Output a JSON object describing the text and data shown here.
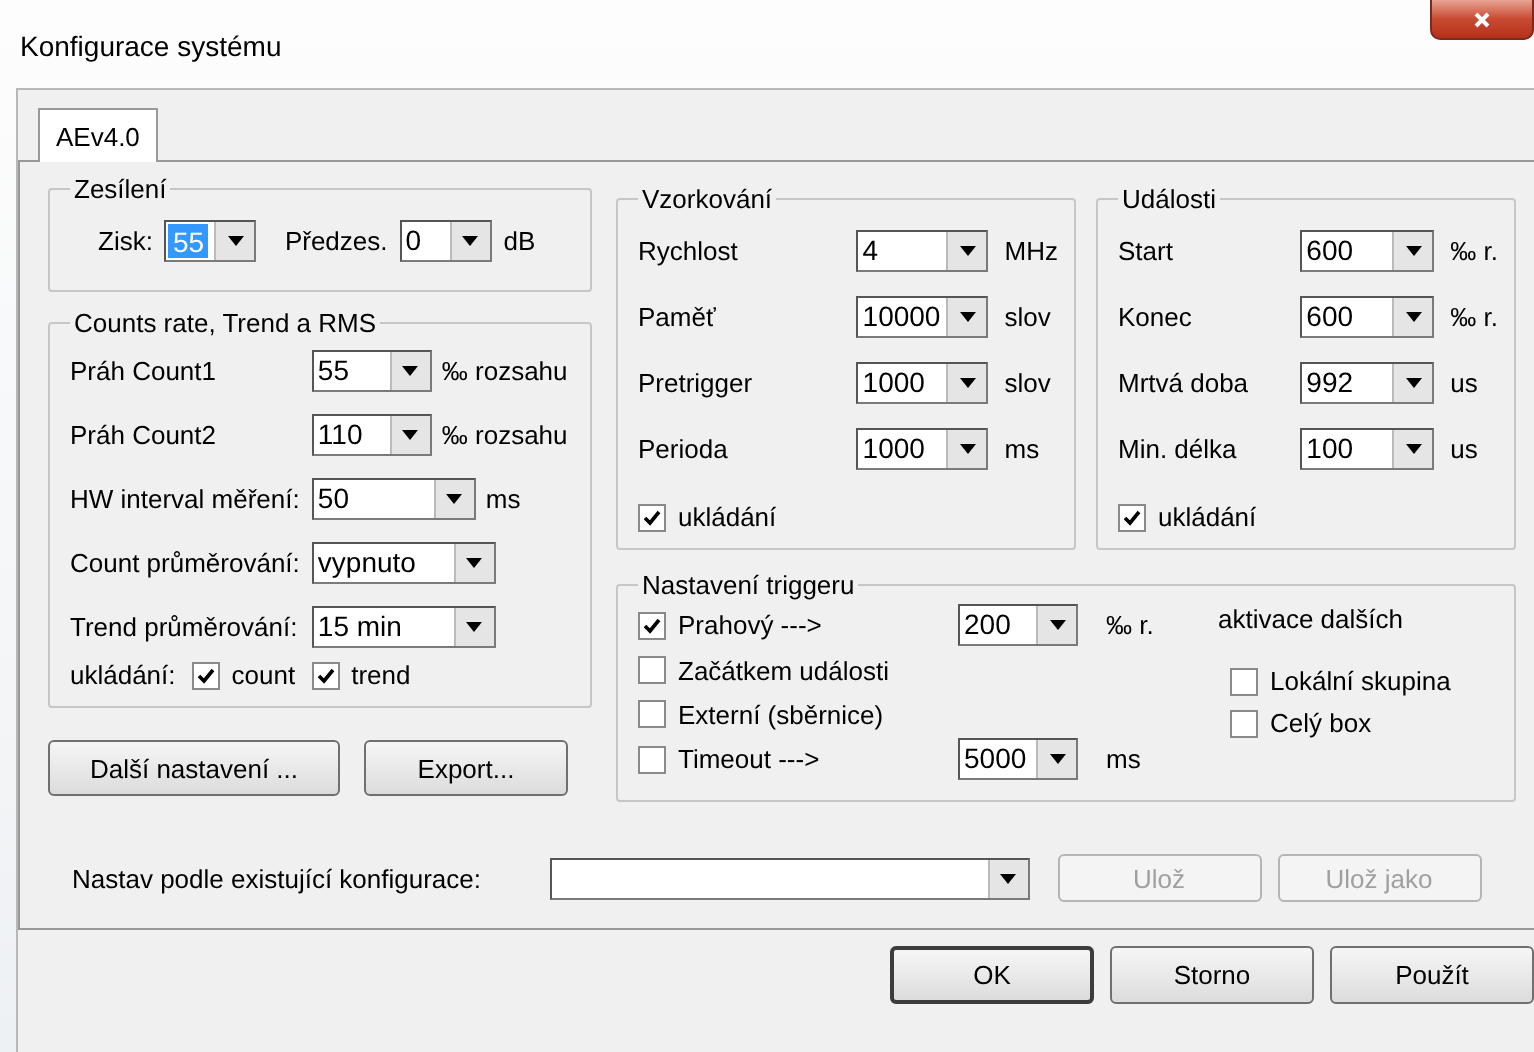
{
  "window": {
    "title": "Konfigurace systému"
  },
  "tabs": [
    {
      "label": "AEv4.0",
      "selected": true
    }
  ],
  "gain": {
    "title": "Zesílení",
    "fields": [
      {
        "label": "Zisk:",
        "value": "55",
        "focused": true
      },
      {
        "label": "Předzes.",
        "value": "0",
        "focused": false,
        "unit": "dB"
      }
    ]
  },
  "counts": {
    "title": "Counts rate, Trend a RMS",
    "rows": [
      {
        "label": "Práh Count1",
        "value": "55",
        "unit": "‰ rozsahu"
      },
      {
        "label": "Práh Count2",
        "value": "110",
        "unit": "‰ rozsahu"
      },
      {
        "label": "HW interval měření:",
        "value": "50",
        "unit": "ms"
      },
      {
        "label": "Count průměrování:",
        "value": "vypnuto"
      },
      {
        "label": "Trend průměrování:",
        "value": "15 min"
      }
    ],
    "save": {
      "label": "ukládání:",
      "options": [
        {
          "label": "count",
          "checked": true
        },
        {
          "label": "trend",
          "checked": true
        }
      ]
    }
  },
  "left_buttons": [
    "Další nastavení ...",
    "Export..."
  ],
  "sampling": {
    "title": "Vzorkování",
    "rows": [
      {
        "label": "Rychlost",
        "value": "4",
        "unit": "MHz"
      },
      {
        "label": "Paměť",
        "value": "10000",
        "unit": "slov"
      },
      {
        "label": "Pretrigger",
        "value": "1000",
        "unit": "slov"
      },
      {
        "label": "Perioda",
        "value": "1000",
        "unit": "ms"
      }
    ],
    "save": {
      "label": "ukládání",
      "checked": true
    }
  },
  "events": {
    "title": "Události",
    "rows": [
      {
        "label": "Start",
        "value": "600",
        "unit": "‰ r."
      },
      {
        "label": "Konec",
        "value": "600",
        "unit": "‰ r."
      },
      {
        "label": "Mrtvá doba",
        "value": "992",
        "unit": "us"
      },
      {
        "label": "Min. délka",
        "value": "100",
        "unit": "us"
      }
    ],
    "save": {
      "label": "ukládání",
      "checked": true
    }
  },
  "trigger": {
    "title": "Nastavení triggeru",
    "options": [
      {
        "label": "Prahový  --->",
        "checked": true,
        "value": "200",
        "unit": "‰ r."
      },
      {
        "label": "Začátkem události",
        "checked": false
      },
      {
        "label": "Externí (sběrnice)",
        "checked": false
      },
      {
        "label": "Timeout  --->",
        "checked": false,
        "value": "5000",
        "unit": "ms"
      }
    ],
    "activation": {
      "title": "aktivace dalších",
      "options": [
        {
          "label": "Lokální skupina",
          "checked": false
        },
        {
          "label": "Celý box",
          "checked": false
        }
      ]
    }
  },
  "preset": {
    "label": "Nastav podle existující konfigurace:",
    "buttons": [
      {
        "label": "Ulož",
        "disabled": true
      },
      {
        "label": "Ulož jako",
        "disabled": true
      }
    ]
  },
  "footer_buttons": [
    {
      "label": "OK",
      "default": true
    },
    {
      "label": "Storno",
      "default": false
    },
    {
      "label": "Použít",
      "default": false
    }
  ]
}
